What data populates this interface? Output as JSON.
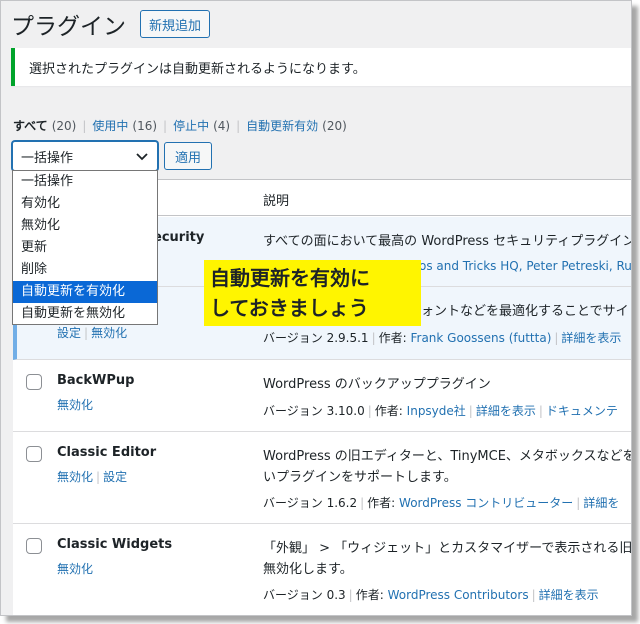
{
  "header": {
    "title": "プラグイン",
    "add_new_label": "新規追加"
  },
  "notice": {
    "text": "選択されたプラグインは自動更新されるようになります。"
  },
  "filters": [
    {
      "label": "すべて",
      "count": "(20)"
    },
    {
      "label": "使用中",
      "count": "(16)"
    },
    {
      "label": "停止中",
      "count": "(4)"
    },
    {
      "label": "自動更新有効",
      "count": "(20)"
    }
  ],
  "bulk": {
    "selected": "一括操作",
    "apply_label": "適用"
  },
  "dropdown_options": [
    "一括操作",
    "有効化",
    "無効化",
    "更新",
    "削除",
    "自動更新を有効化",
    "自動更新を無効化"
  ],
  "table": {
    "desc_header": "説明"
  },
  "rows": [
    {
      "name_partial": "ecurity",
      "desc": "すべての面において最高の WordPress セキュリティプラグイン",
      "meta_partial": "os and Tricks HQ, Peter Petreski, Ruhu"
    },
    {
      "actions": [
        "設定",
        "無効化"
      ],
      "desc_partial": "ォントなどを最適化することでサイ",
      "meta": {
        "version": "バージョン 2.9.5.1",
        "by": "作者:",
        "author": "Frank Goossens (futtta)",
        "details": "詳細を表示"
      }
    },
    {
      "name": "BackWPup",
      "actions": [
        "無効化"
      ],
      "desc": "WordPress のバックアッププラグイン",
      "meta": {
        "version": "バージョン 3.10.0",
        "by": "作者:",
        "author": "Inpsyde社",
        "details": "詳細を表示",
        "docs": "ドキュメンテ"
      }
    },
    {
      "name": "Classic Editor",
      "actions": [
        "無効化",
        "設定"
      ],
      "desc": "WordPress の旧エディターと、TinyMCE、メタボックスなどを含",
      "desc2": "いプラグインをサポートします。",
      "meta": {
        "version": "バージョン 1.6.2",
        "by": "作者:",
        "author": "WordPress コントリビューター",
        "details": "詳細を"
      }
    },
    {
      "name": "Classic Widgets",
      "actions": [
        "無効化"
      ],
      "desc": "「外観」 > 「ウィジェット」とカスタマイザーで表示される旧",
      "desc2": "無効化します。",
      "meta": {
        "version": "バージョン 0.3",
        "by": "作者:",
        "author": "WordPress Contributors",
        "details": "詳細を表示"
      }
    }
  ],
  "callout": {
    "line1": "自動更新を有効に",
    "line2": "しておきましょう"
  }
}
